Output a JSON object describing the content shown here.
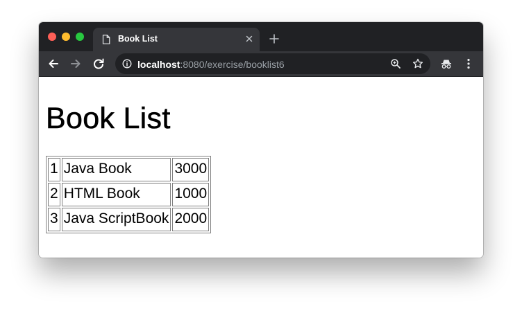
{
  "browser": {
    "tab": {
      "title": "Book List"
    },
    "address_bar": {
      "host": "localhost",
      "rest": ":8080/exercise/booklist6"
    }
  },
  "page": {
    "title": "Book List",
    "books": [
      {
        "no": "1",
        "title": "Java Book",
        "price": "3000"
      },
      {
        "no": "2",
        "title": "HTML Book",
        "price": "1000"
      },
      {
        "no": "3",
        "title": "Java ScriptBook",
        "price": "2000"
      }
    ]
  },
  "colors": {
    "tabstrip": "#202124",
    "toolbar": "#35363a",
    "omnibox": "#202124",
    "close": "#fe5f57",
    "minimize": "#febc2e",
    "maximize": "#28c840"
  }
}
